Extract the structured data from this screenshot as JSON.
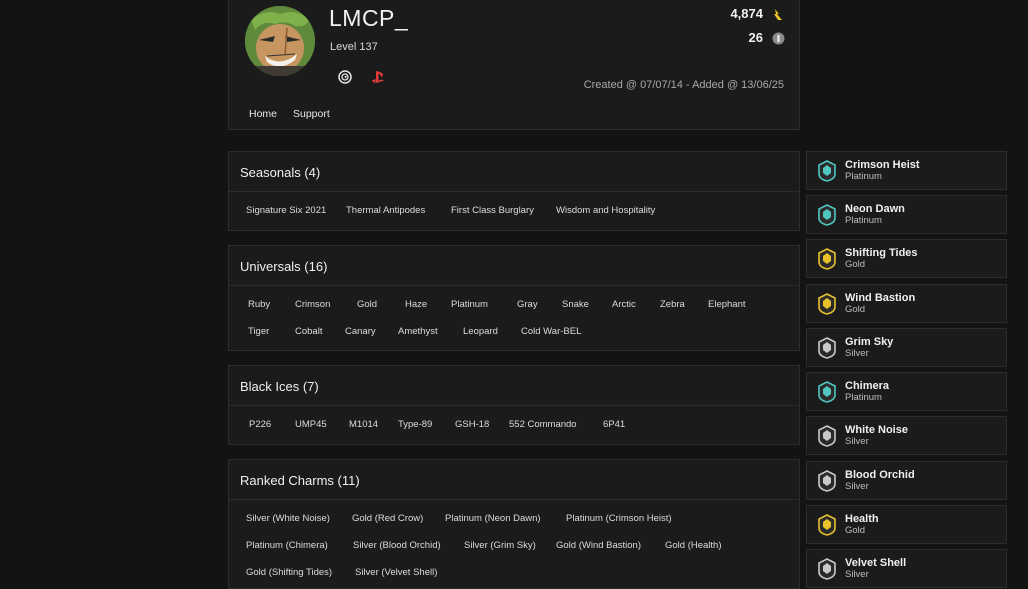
{
  "profile": {
    "username": "LMCP_",
    "level": "Level 137",
    "stat_1": "4,874",
    "stat_2": "26",
    "created": "Created @ 07/07/14 - Added @ 13/06/25",
    "platforms": [
      "ubisoft-icon",
      "playstation-icon"
    ]
  },
  "nav": {
    "home": "Home",
    "support": "Support"
  },
  "sections": {
    "seasonals": {
      "title": "Seasonals (4)",
      "items": [
        "Signature Six 2021",
        "Thermal Antipodes",
        "First Class Burglary",
        "Wisdom and Hospitality"
      ]
    },
    "universals": {
      "title": "Universals (16)",
      "items": [
        "Ruby",
        "Crimson",
        "Gold",
        "Haze",
        "Platinum",
        "Gray",
        "Snake",
        "Arctic",
        "Zebra",
        "Elephant",
        "Tiger",
        "Cobalt",
        "Canary",
        "Amethyst",
        "Leopard",
        "Cold War-BEL"
      ]
    },
    "black_ices": {
      "title": "Black Ices (7)",
      "items": [
        "P226",
        "UMP45",
        "M1014",
        "Type-89",
        "GSH-18",
        "552 Commando",
        "6P41"
      ]
    },
    "ranked_charms": {
      "title": "Ranked Charms (11)",
      "items": [
        "Silver (White Noise)",
        "Gold (Red Crow)",
        "Platinum (Neon Dawn)",
        "Platinum (Crimson Heist)",
        "Platinum (Chimera)",
        "Silver (Blood Orchid)",
        "Silver (Grim Sky)",
        "Gold (Wind Bastion)",
        "Gold (Health)",
        "Gold (Shifting Tides)",
        "Silver (Velvet Shell)"
      ]
    }
  },
  "seasons": [
    {
      "name": "Crimson Heist",
      "rank": "Platinum",
      "color": "#4fc7c0"
    },
    {
      "name": "Neon Dawn",
      "rank": "Platinum",
      "color": "#4fc7c0"
    },
    {
      "name": "Shifting Tides",
      "rank": "Gold",
      "color": "#e8c22b"
    },
    {
      "name": "Wind Bastion",
      "rank": "Gold",
      "color": "#e8c22b"
    },
    {
      "name": "Grim Sky",
      "rank": "Silver",
      "color": "#c9c9c9"
    },
    {
      "name": "Chimera",
      "rank": "Platinum",
      "color": "#4fc7c0"
    },
    {
      "name": "White Noise",
      "rank": "Silver",
      "color": "#c9c9c9"
    },
    {
      "name": "Blood Orchid",
      "rank": "Silver",
      "color": "#c9c9c9"
    },
    {
      "name": "Health",
      "rank": "Gold",
      "color": "#e8c22b"
    },
    {
      "name": "Velvet Shell",
      "rank": "Silver",
      "color": "#c9c9c9"
    }
  ],
  "colors": {
    "background": "#131313",
    "panel": "#1b1b1b",
    "border": "#2c2c2c",
    "renown": "#e8c22b"
  }
}
